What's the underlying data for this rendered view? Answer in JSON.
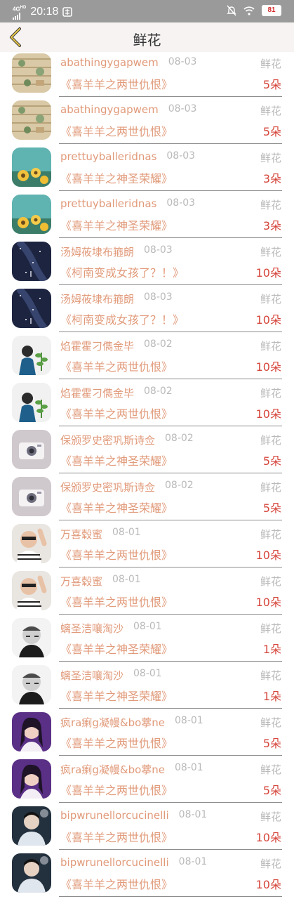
{
  "status_bar": {
    "network": "4G",
    "network_sup": "HD",
    "time": "20:18",
    "battery": "81"
  },
  "header": {
    "title": "鲜花"
  },
  "rows": [
    {
      "name": "abathingygapwem",
      "date": "08-03",
      "gift": "鲜花",
      "show": "《喜羊羊之两世仇恨》",
      "count": "5朵",
      "avatar": "avatar-pattern"
    },
    {
      "name": "abathingygapwem",
      "date": "08-03",
      "gift": "鲜花",
      "show": "《喜羊羊之两世仇恨》",
      "count": "5朵",
      "avatar": "avatar-pattern"
    },
    {
      "name": "prettuyballeridnas",
      "date": "08-03",
      "gift": "鲜花",
      "show": "《喜羊羊之神圣荣耀》",
      "count": "3朵",
      "avatar": "avatar-sunflower"
    },
    {
      "name": "prettuyballeridnas",
      "date": "08-03",
      "gift": "鲜花",
      "show": "《喜羊羊之神圣荣耀》",
      "count": "3朵",
      "avatar": "avatar-sunflower"
    },
    {
      "name": "汤姆莜埭布箍朗",
      "date": "08-03",
      "gift": "鲜花",
      "show": "《柯南变成女孩了？！》",
      "count": "10朵",
      "avatar": "avatar-starry-sky"
    },
    {
      "name": "汤姆莜埭布箍朗",
      "date": "08-03",
      "gift": "鲜花",
      "show": "《柯南变成女孩了？！》",
      "count": "10朵",
      "avatar": "avatar-starry-sky"
    },
    {
      "name": "焰霍霍刁儁金毕",
      "date": "08-02",
      "gift": "鲜花",
      "show": "《喜羊羊之两世仇恨》",
      "count": "10朵",
      "avatar": "avatar-girl-plant"
    },
    {
      "name": "焰霍霍刁儁金毕",
      "date": "08-02",
      "gift": "鲜花",
      "show": "《喜羊羊之两世仇恨》",
      "count": "10朵",
      "avatar": "avatar-girl-plant"
    },
    {
      "name": "保颁罗史密巩斯诗佥",
      "date": "08-02",
      "gift": "鲜花",
      "show": "《喜羊羊之神圣荣耀》",
      "count": "5朵",
      "avatar": "avatar-camera"
    },
    {
      "name": "保颁罗史密巩斯诗佥",
      "date": "08-02",
      "gift": "鲜花",
      "show": "《喜羊羊之神圣荣耀》",
      "count": "5朵",
      "avatar": "avatar-camera"
    },
    {
      "name": "万喜毂蜜",
      "date": "08-01",
      "gift": "鲜花",
      "show": "《喜羊羊之两世仇恨》",
      "count": "10朵",
      "avatar": "avatar-boy-wave"
    },
    {
      "name": "万喜毂蜜",
      "date": "08-01",
      "gift": "鲜花",
      "show": "《喜羊羊之两世仇恨》",
      "count": "10朵",
      "avatar": "avatar-boy-wave"
    },
    {
      "name": "螭圣洁嚷淘沙",
      "date": "08-01",
      "gift": "鲜花",
      "show": "《喜羊羊之神圣荣耀》",
      "count": "1朵",
      "avatar": "avatar-bw-man"
    },
    {
      "name": "螭圣洁嚷淘沙",
      "date": "08-01",
      "gift": "鲜花",
      "show": "《喜羊羊之神圣荣耀》",
      "count": "1朵",
      "avatar": "avatar-bw-man"
    },
    {
      "name": "疯ra瘌g凝幔&bo藆ne",
      "date": "08-01",
      "gift": "鲜花",
      "show": "《喜羊羊之两世仇恨》",
      "count": "5朵",
      "avatar": "avatar-purple-girl"
    },
    {
      "name": "疯ra瘌g凝幔&bo藆ne",
      "date": "08-01",
      "gift": "鲜花",
      "show": "《喜羊羊之两世仇恨》",
      "count": "5朵",
      "avatar": "avatar-purple-girl"
    },
    {
      "name": "bipwrunellorcucinelli",
      "date": "08-01",
      "gift": "鲜花",
      "show": "《喜羊羊之两世仇恨》",
      "count": "10朵",
      "avatar": "avatar-dark-boy"
    },
    {
      "name": "bipwrunellorcucinelli",
      "date": "08-01",
      "gift": "鲜花",
      "show": "《喜羊羊之两世仇恨》",
      "count": "10朵",
      "avatar": "avatar-dark-boy"
    }
  ]
}
